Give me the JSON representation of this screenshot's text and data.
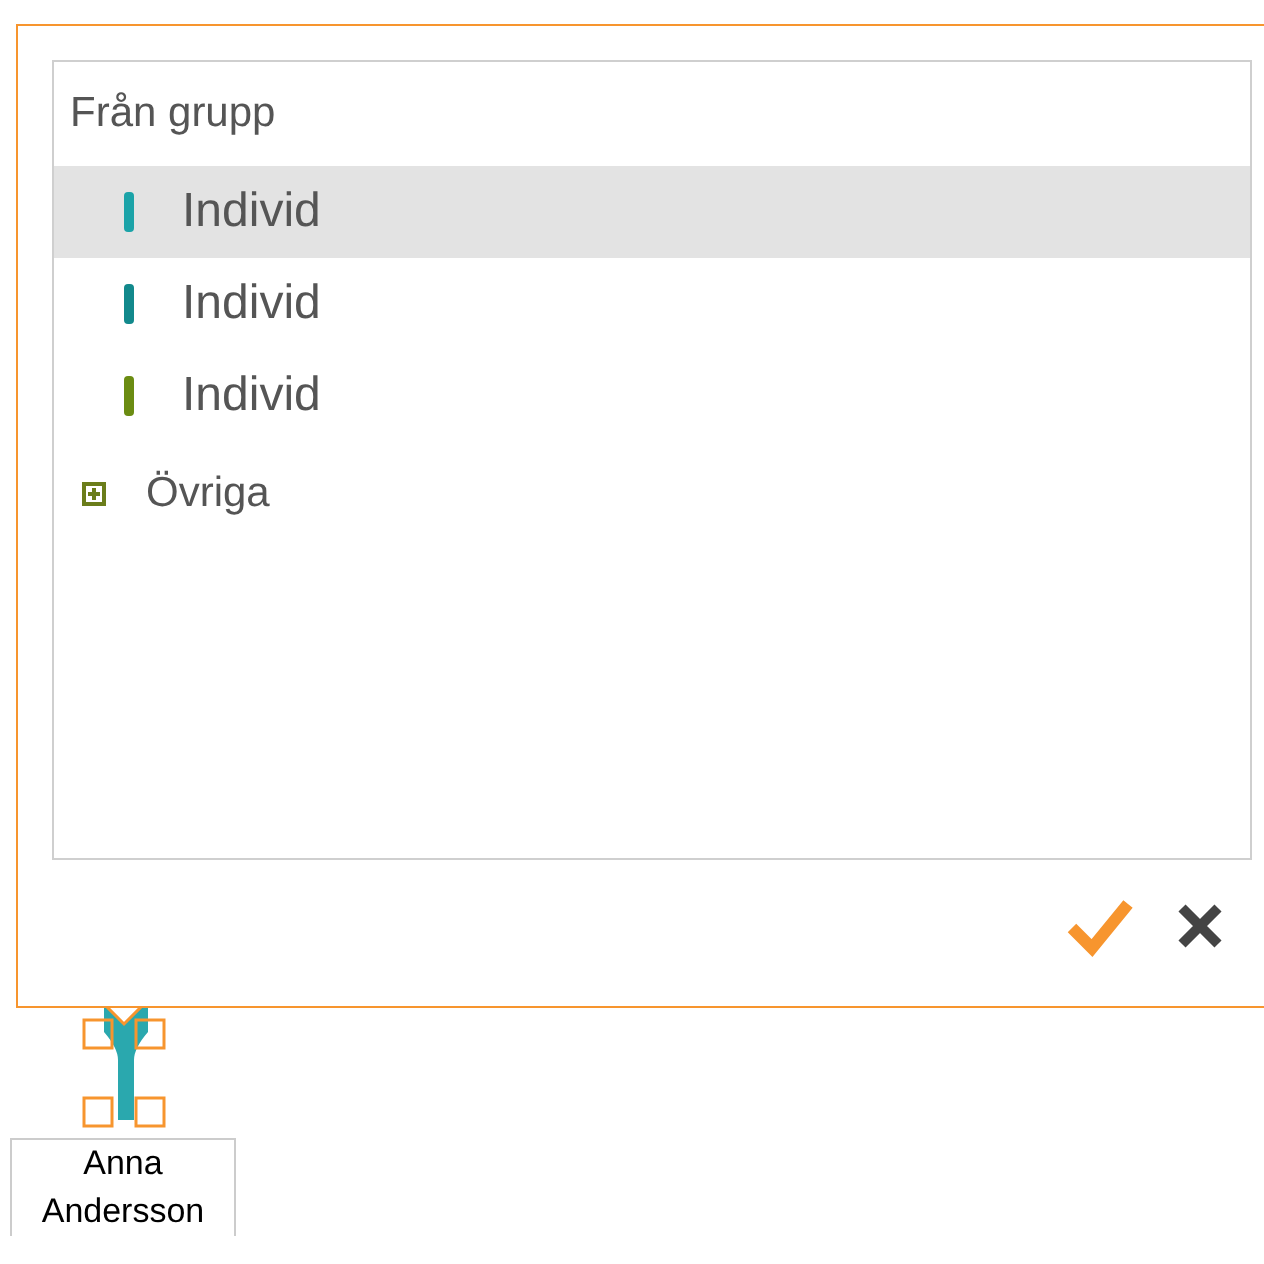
{
  "popup": {
    "list": {
      "header": "Från grupp",
      "items": [
        {
          "label": "Individ",
          "color": "#1ba3a8",
          "selected": true
        },
        {
          "label": "Individ",
          "color": "#12898c",
          "selected": false
        },
        {
          "label": "Individ",
          "color": "#6b8c12",
          "selected": false
        }
      ],
      "groups": [
        {
          "label": "Övriga",
          "expanded": false
        }
      ]
    }
  },
  "node": {
    "label": "Anna Andersson"
  }
}
